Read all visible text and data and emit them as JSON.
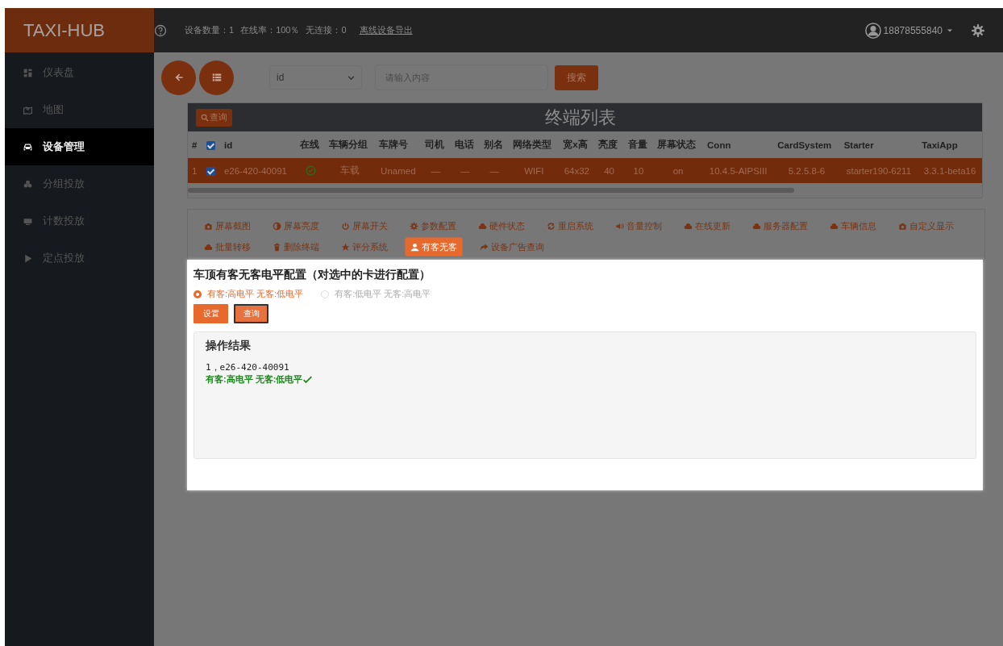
{
  "topbar": {
    "brand": "TAXI-HUB",
    "stats": [
      "设备数量：1",
      "在线率：100％",
      "无连接：0"
    ],
    "export_link": "离线设备导出",
    "user": "18878555840"
  },
  "sidebar": {
    "items": [
      {
        "label": "仪表盘",
        "selected": false
      },
      {
        "label": "地图",
        "selected": false
      },
      {
        "label": "设备管理",
        "selected": true
      },
      {
        "label": "分组投放",
        "selected": false
      },
      {
        "label": "计数投放",
        "selected": false
      },
      {
        "label": "定点投放",
        "selected": false
      }
    ]
  },
  "search": {
    "field": "id",
    "placeholder": "请输入内容",
    "button": "搜索"
  },
  "table": {
    "query_button": "查询",
    "title": "终端列表",
    "columns": [
      "#",
      "",
      "id",
      "在线",
      "车辆分组",
      "车牌号",
      "司机",
      "电话",
      "别名",
      "网络类型",
      "宽x高",
      "亮度",
      "音量",
      "屏幕状态",
      "Conn",
      "CardSystem",
      "Starter",
      "TaxiApp"
    ],
    "all_checked": true,
    "rows": [
      {
        "selected": true,
        "checked": true,
        "online": true,
        "cells": [
          "1",
          "",
          "e26-420-40091",
          "",
          "车载",
          "Unamed",
          "—",
          "—",
          "—",
          "WIFI",
          "64x32",
          "40",
          "10",
          "on",
          "10.4.5-AIPSIII",
          "5.2.5.8-6",
          "starter190-6211",
          "3.3.1-beta16"
        ]
      }
    ]
  },
  "actions": [
    {
      "label": "屏幕截图",
      "selected": false
    },
    {
      "label": "屏幕亮度",
      "selected": false
    },
    {
      "label": "屏幕开关",
      "selected": false
    },
    {
      "label": "参数配置",
      "selected": false
    },
    {
      "label": "硬件状态",
      "selected": false
    },
    {
      "label": "重启系统",
      "selected": false
    },
    {
      "label": "音量控制",
      "selected": false
    },
    {
      "label": "在线更新",
      "selected": false
    },
    {
      "label": "服务器配置",
      "selected": false
    },
    {
      "label": "车辆信息",
      "selected": false
    },
    {
      "label": "自定义显示",
      "selected": false
    },
    {
      "label": "批量转移",
      "selected": false
    },
    {
      "label": "删除终端",
      "selected": false
    },
    {
      "label": "评分系统",
      "selected": false
    },
    {
      "label": "有客无客",
      "selected": true
    },
    {
      "label": "设备广告查询",
      "selected": false
    }
  ],
  "config": {
    "title": "车顶有客无客电平配置（对选中的卡进行配置）",
    "options": [
      {
        "label": "有客:高电平 无客:低电平",
        "selected": true
      },
      {
        "label": "有客:低电平 无客:高电平",
        "selected": false
      }
    ],
    "buttons": [
      {
        "label": "设置",
        "focused": false
      },
      {
        "label": "查询",
        "focused": true
      }
    ],
    "result": {
      "title": "操作结果",
      "lines": [
        {
          "kind": "plain",
          "text": "1，e26-420-40091"
        },
        {
          "kind": "success",
          "text": "有客:高电平 无客:低电平"
        }
      ]
    }
  }
}
